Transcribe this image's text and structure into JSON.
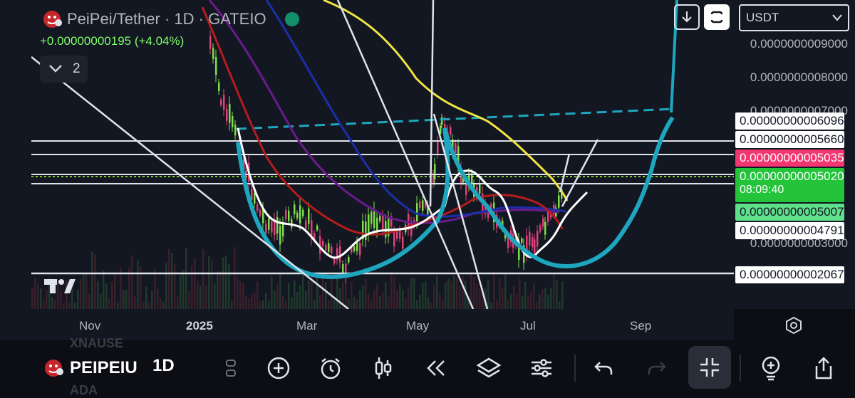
{
  "legend": {
    "symbol_title": "PeiPei/Tether · 1D · GATEIO",
    "change": "+0.00000000195 (+4.04%)",
    "indicators_count": "2"
  },
  "toolbar_top": {
    "currency": "USDT"
  },
  "price_scale": {
    "ticks": [
      {
        "label": "0.0000000009000",
        "value": 9e-10
      },
      {
        "label": "0.0000000008000",
        "value": 8e-10
      },
      {
        "label": "0.0000000007000",
        "value": 7e-10
      },
      {
        "label": "0.0000000003000",
        "value": 3e-10
      }
    ],
    "tags": {
      "tag1": "0.00000000006096",
      "tag2": "0.00000000005660",
      "tag3": "0.00000000005035",
      "tag4": "0.00000000005020",
      "countdown": "08:09:40",
      "tag5": "0.00000000005007",
      "tag6": "0.00000000004791",
      "tag7": "0.00000000002067"
    }
  },
  "time_axis": {
    "labels": [
      "Nov",
      "2025",
      "Mar",
      "May",
      "Jul",
      "Sep"
    ]
  },
  "bottom": {
    "symbol": "PEIPEIU",
    "interval": "1D",
    "ghost_top": "XNAUSE",
    "ghost_bottom": "ADA"
  },
  "colors": {
    "accent_cyan": "#1fa6bf",
    "ma_yellow": "#f0e442",
    "ma_red": "#b51c1c",
    "ma_blue": "#1b2fa8",
    "ma_purple": "#6a1b8c",
    "candle_up": "#7fdc4a",
    "candle_down": "#e0427a",
    "tag_pink": "#f23672",
    "tag_green": "#23c43a"
  }
}
